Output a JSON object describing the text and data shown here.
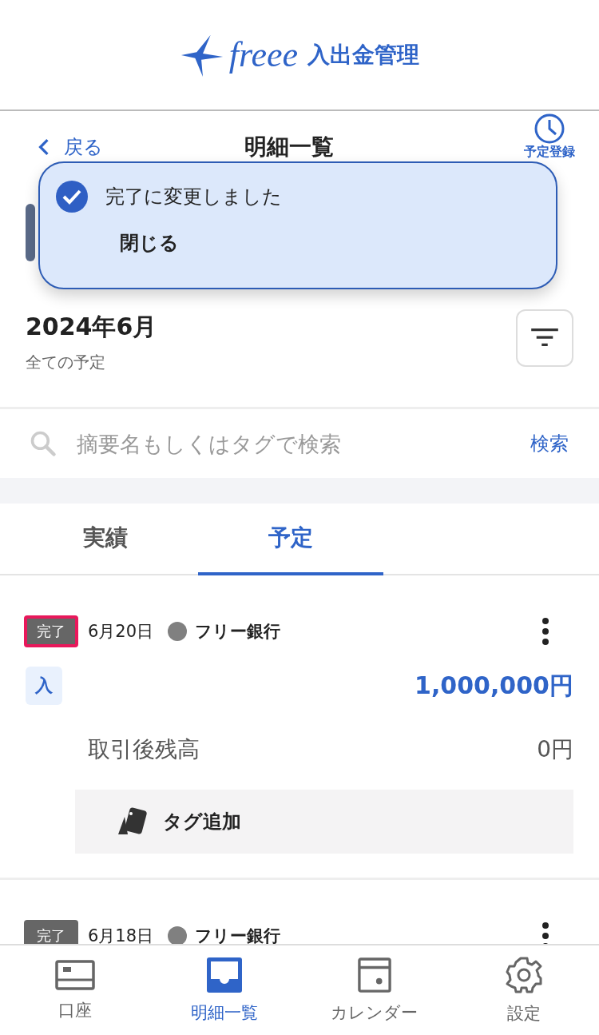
{
  "app": {
    "logo_text": "freee",
    "product_name": "入出金管理"
  },
  "nav": {
    "back": "戻る",
    "title": "明細一覧",
    "schedule": "予定登録"
  },
  "toast": {
    "message": "完了に変更しました",
    "close": "閉じる"
  },
  "period": {
    "month": "2024年6月",
    "filter": "全ての予定"
  },
  "search": {
    "placeholder": "摘要名もしくはタグで検索",
    "button": "検索"
  },
  "tabs": [
    {
      "label": "実績",
      "selected": false
    },
    {
      "label": "予定",
      "selected": true
    }
  ],
  "transactions": [
    {
      "status": "完了",
      "highlighted": true,
      "date": "6月20日",
      "account": "フリー銀行",
      "color": "#808080",
      "direction": "入",
      "amount": "1,000,000円",
      "balance_label": "取引後残高",
      "balance": "0円",
      "tag_button": "タグ追加"
    },
    {
      "status": "完了",
      "highlighted": false,
      "date": "6月18日",
      "account": "フリー銀行",
      "color": "#808080"
    }
  ],
  "bottom_nav": [
    {
      "label": "口座",
      "selected": false
    },
    {
      "label": "明細一覧",
      "selected": true
    },
    {
      "label": "カレンダー",
      "selected": false
    },
    {
      "label": "設定",
      "selected": false
    }
  ]
}
